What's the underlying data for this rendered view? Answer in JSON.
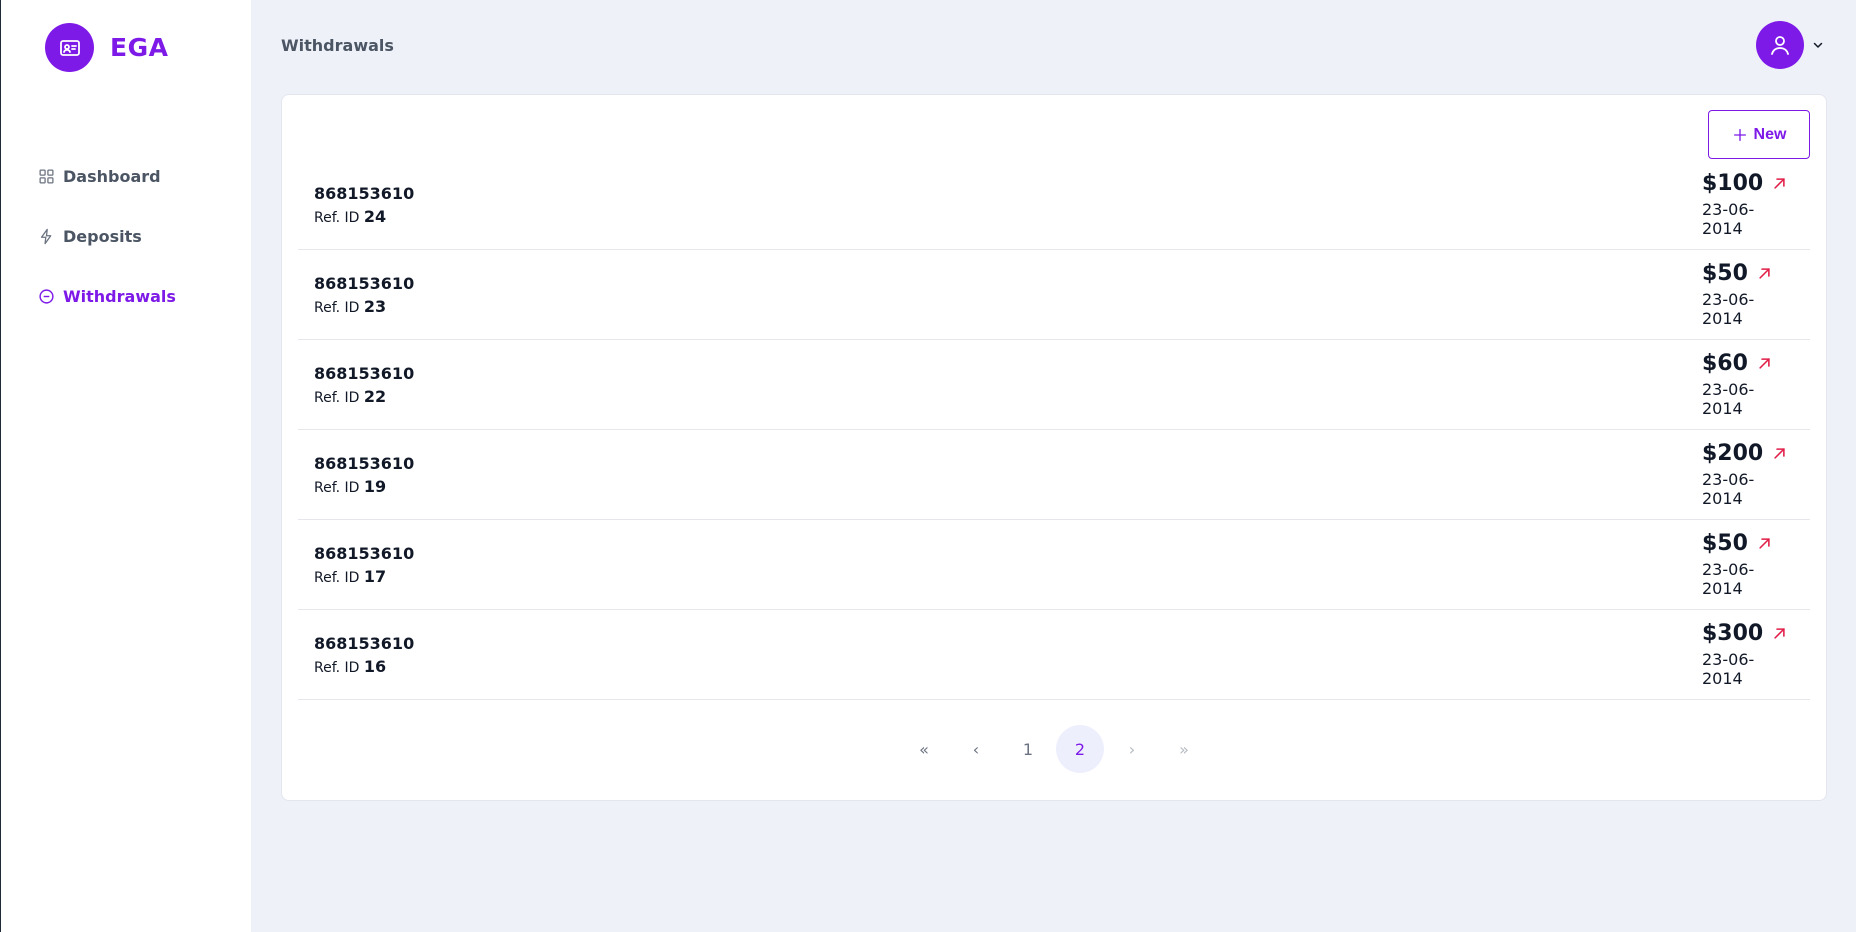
{
  "brand": {
    "name": "EGA",
    "logo_icon": "id-card-icon",
    "color": "#7e1ae8"
  },
  "sidebar": {
    "items": [
      {
        "label": "Dashboard",
        "icon": "grid-icon",
        "active": false
      },
      {
        "label": "Deposits",
        "icon": "lightning-icon",
        "active": false
      },
      {
        "label": "Withdrawals",
        "icon": "minus-circle-icon",
        "active": true
      }
    ]
  },
  "header": {
    "title": "Withdrawals",
    "avatar_icon": "user-icon",
    "menu_icon": "chevron-down-icon"
  },
  "actions": {
    "new_label": "New",
    "new_icon": "plus-icon"
  },
  "withdrawals": [
    {
      "account": "868153610",
      "ref_label": "Ref. ID",
      "ref_id": "24",
      "amount": "$100",
      "date": "23-06-2014"
    },
    {
      "account": "868153610",
      "ref_label": "Ref. ID",
      "ref_id": "23",
      "amount": "$50",
      "date": "23-06-2014"
    },
    {
      "account": "868153610",
      "ref_label": "Ref. ID",
      "ref_id": "22",
      "amount": "$60",
      "date": "23-06-2014"
    },
    {
      "account": "868153610",
      "ref_label": "Ref. ID",
      "ref_id": "19",
      "amount": "$200",
      "date": "23-06-2014"
    },
    {
      "account": "868153610",
      "ref_label": "Ref. ID",
      "ref_id": "17",
      "amount": "$50",
      "date": "23-06-2014"
    },
    {
      "account": "868153610",
      "ref_label": "Ref. ID",
      "ref_id": "16",
      "amount": "$300",
      "date": "23-06-2014"
    }
  ],
  "pagination": {
    "first": "«",
    "prev": "‹",
    "pages": [
      "1",
      "2"
    ],
    "current": "2",
    "next": "›",
    "last": "»"
  },
  "colors": {
    "accent": "#7e1ae8",
    "withdraw_arrow": "#e11d48",
    "background": "#eef1f8"
  }
}
